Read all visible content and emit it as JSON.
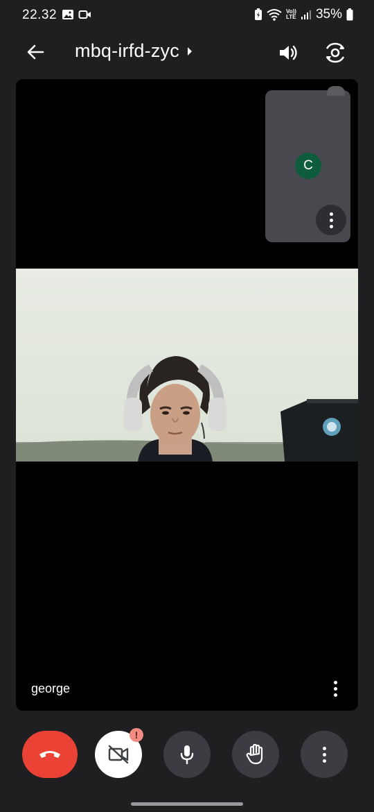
{
  "status_bar": {
    "time": "22.32",
    "volte_label_top": "Vo))",
    "volte_label_bottom": "LTE",
    "battery_percent": "35%"
  },
  "top_bar": {
    "meeting_code": "mbq-irfd-zyc"
  },
  "self_view": {
    "avatar_initial": "C",
    "avatar_color": "#0d5c3d"
  },
  "main_tile": {
    "participant_name": "george"
  },
  "controls": {
    "end_call_color": "#ea4335",
    "camera_warning": "!"
  },
  "icons": [
    "back-arrow-icon",
    "speaker-icon",
    "switch-camera-icon",
    "more-vert-icon",
    "hangup-icon",
    "camera-off-icon",
    "mic-icon",
    "raise-hand-icon"
  ]
}
